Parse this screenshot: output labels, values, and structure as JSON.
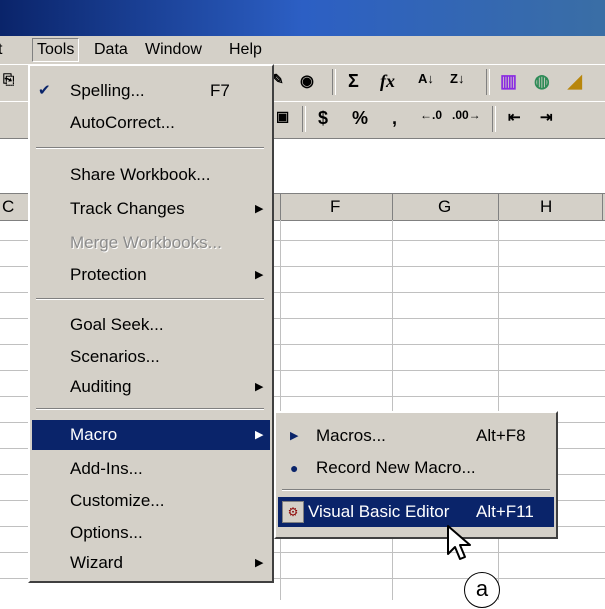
{
  "menubar": {
    "items": [
      "t",
      "Tools",
      "Data",
      "Window",
      "Help"
    ]
  },
  "toolbar": {
    "glyphs": [
      "Σ",
      "fx",
      "$",
      "%",
      ","
    ]
  },
  "columns": [
    "C",
    "F",
    "G",
    "H"
  ],
  "tools_menu": {
    "items": [
      {
        "label": "Spelling...",
        "shortcut": "F7"
      },
      {
        "label": "AutoCorrect..."
      },
      {
        "label": "Share Workbook..."
      },
      {
        "label": "Track Changes"
      },
      {
        "label": "Merge Workbooks...",
        "disabled": true
      },
      {
        "label": "Protection"
      },
      {
        "label": "Goal Seek..."
      },
      {
        "label": "Scenarios..."
      },
      {
        "label": "Auditing"
      },
      {
        "label": "Macro"
      },
      {
        "label": "Add-Ins..."
      },
      {
        "label": "Customize..."
      },
      {
        "label": "Options..."
      },
      {
        "label": "Wizard"
      }
    ]
  },
  "macro_submenu": {
    "items": [
      {
        "label": "Macros...",
        "shortcut": "Alt+F8"
      },
      {
        "label": "Record New Macro..."
      },
      {
        "label": "Visual Basic Editor",
        "shortcut": "Alt+F11"
      }
    ]
  },
  "annotation": "a",
  "colors": {
    "highlight": "#0a246a",
    "face": "#d4d0c8"
  }
}
